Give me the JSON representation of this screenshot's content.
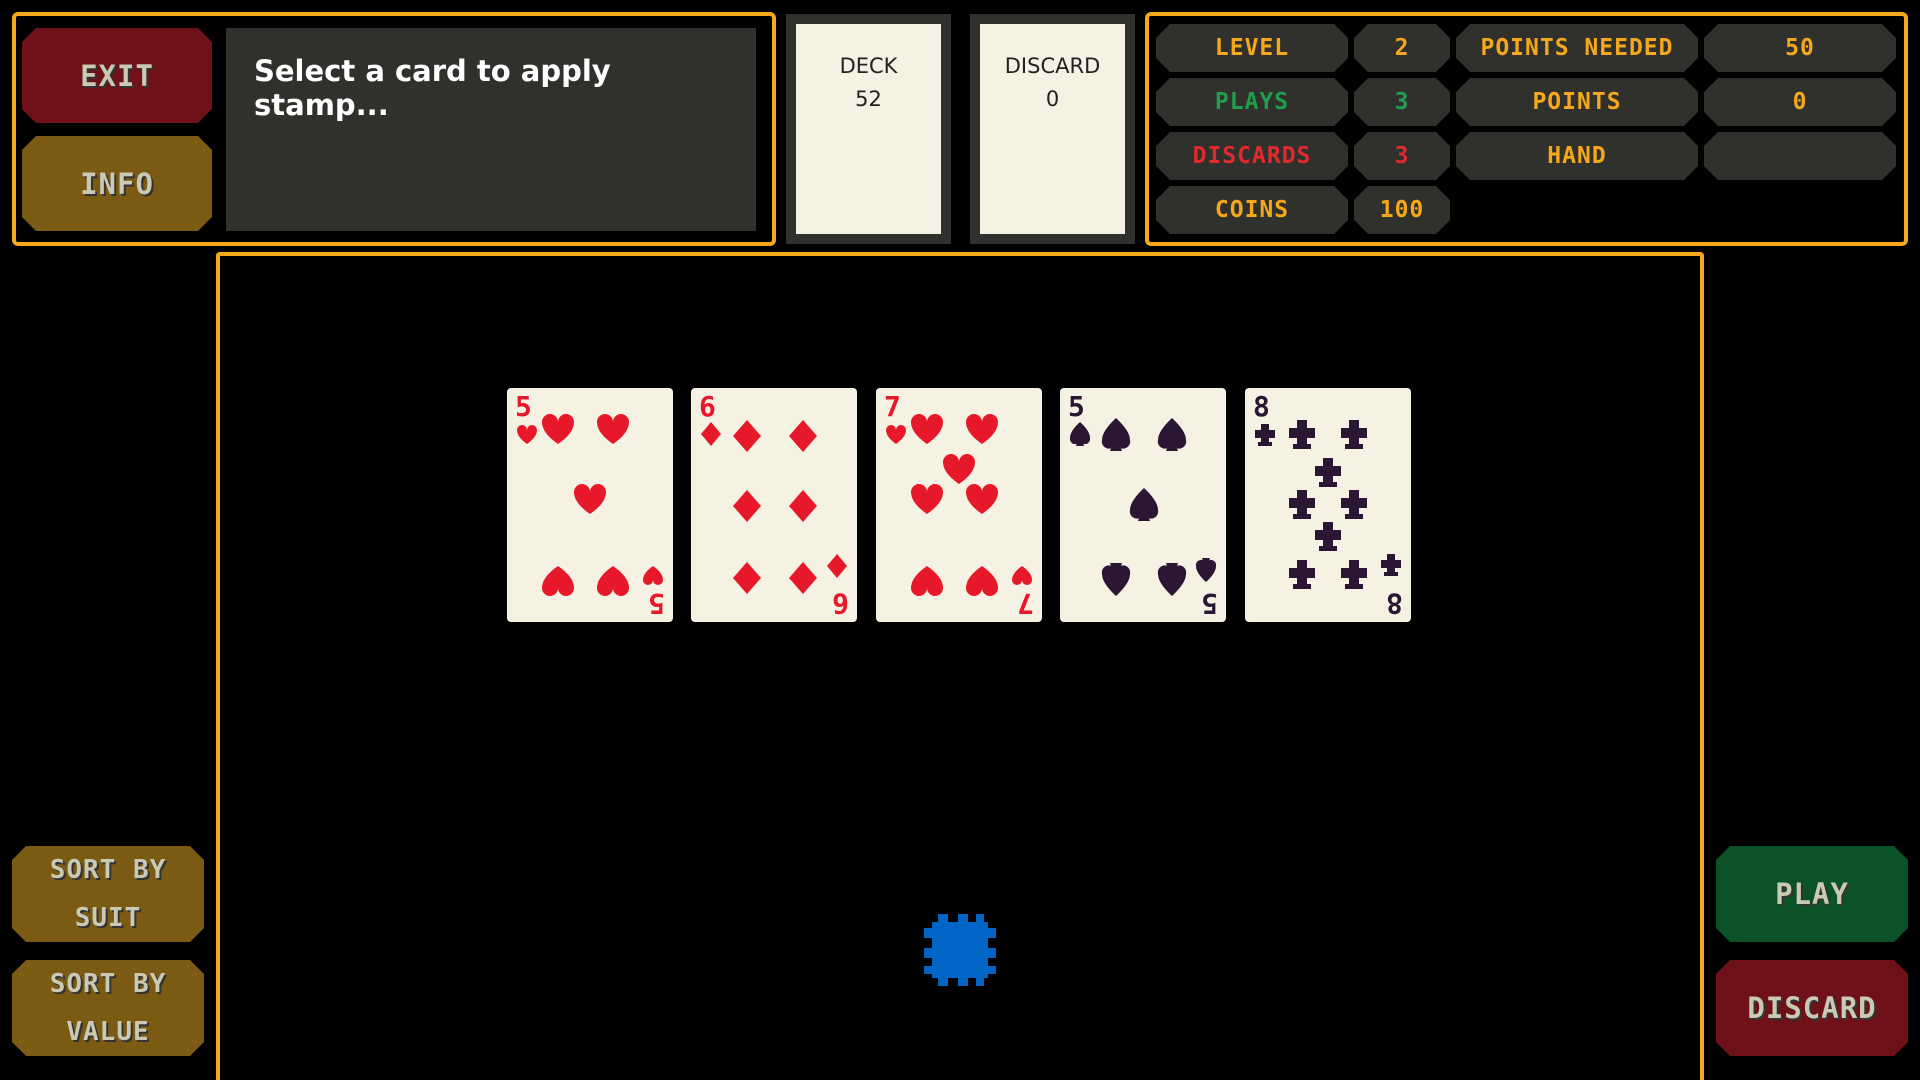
{
  "header": {
    "exit_label": "EXIT",
    "info_label": "INFO",
    "message": "Select a card to apply stamp..."
  },
  "piles": {
    "deck": {
      "label": "DECK",
      "count": "52"
    },
    "discard": {
      "label": "DISCARD",
      "count": "0"
    }
  },
  "stats": {
    "level": {
      "label": "LEVEL",
      "value": "2"
    },
    "plays": {
      "label": "PLAYS",
      "value": "3"
    },
    "discards": {
      "label": "DISCARDS",
      "value": "3"
    },
    "coins": {
      "label": "COINS",
      "value": "100"
    },
    "points_needed": {
      "label": "POINTS NEEDED",
      "value": "50"
    },
    "points": {
      "label": "POINTS",
      "value": "0"
    },
    "hand": {
      "label": "HAND",
      "value": ""
    }
  },
  "hand": {
    "cards": [
      {
        "rank": "5",
        "suit": "hearts",
        "color": "#e8182b"
      },
      {
        "rank": "6",
        "suit": "diamonds",
        "color": "#e8182b"
      },
      {
        "rank": "7",
        "suit": "hearts",
        "color": "#e8182b"
      },
      {
        "rank": "5",
        "suit": "spades",
        "color": "#2b1733"
      },
      {
        "rank": "8",
        "suit": "clubs",
        "color": "#2b1733"
      }
    ]
  },
  "controls": {
    "sort_suit_line1": "SORT BY",
    "sort_suit_line2": "SUIT",
    "sort_value_line1": "SORT BY",
    "sort_value_line2": "VALUE",
    "play_label": "PLAY",
    "discard_label": "DISCARD"
  },
  "colors": {
    "accent": "#f5a81c",
    "chip": "#0065c4",
    "plays": "#1f9e4c",
    "discards": "#e02a2e"
  },
  "icons": {
    "chip": "poker-chip-icon"
  }
}
